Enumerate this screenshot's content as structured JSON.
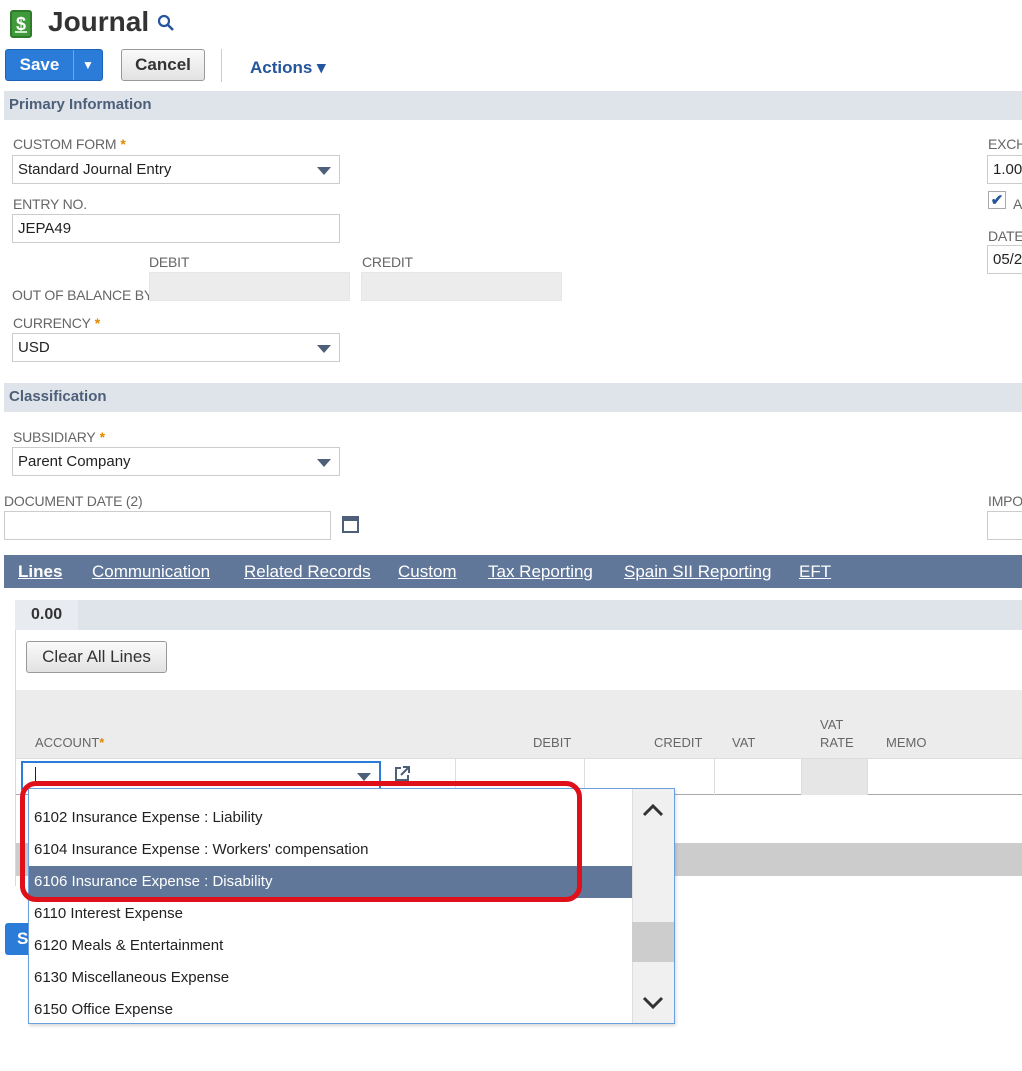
{
  "header": {
    "icon_glyph": "$",
    "title": "Journal"
  },
  "toolbar": {
    "save_label": "Save",
    "save_menu_glyph": "▼",
    "cancel_label": "Cancel",
    "actions_label": "Actions ▾"
  },
  "sections": {
    "primary": "Primary Information",
    "classification": "Classification"
  },
  "primary": {
    "custom_form_label": "Custom Form",
    "custom_form_value": "Standard Journal Entry",
    "entry_no_label": "Entry No.",
    "entry_no_value": "JEPA49",
    "debit_label": "Debit",
    "credit_label": "Credit",
    "out_of_balance_label": "Out of Balance By",
    "currency_label": "Currency",
    "currency_value": "USD",
    "exch_label": "EXCH",
    "exch_value": "1.00",
    "checkbox_label": "A",
    "checkbox_glyph": "✔",
    "date_label": "DATE",
    "date_value": "05/2"
  },
  "classification": {
    "subsidiary_label": "Subsidiary",
    "subsidiary_value": "Parent Company",
    "document_date_label": "Document Date (2)",
    "document_date_value": "",
    "impo_label": "IMPO"
  },
  "required_marker": "*",
  "tabs": [
    {
      "label": "Lines"
    },
    {
      "label": "Communication"
    },
    {
      "label": "Related Records"
    },
    {
      "label": "Custom"
    },
    {
      "label": "Tax Reporting"
    },
    {
      "label": "Spain SII Reporting"
    },
    {
      "label": "EFT"
    }
  ],
  "lines": {
    "total": "0.00",
    "clear_all_label": "Clear All Lines",
    "columns": {
      "account": "Account",
      "debit": "Debit",
      "credit": "Credit",
      "vat": "VAT",
      "vat_rate_1": "VAT",
      "vat_rate_2": "Rate",
      "memo": "Memo"
    }
  },
  "dropdown": {
    "items": [
      {
        "label": "6102 Insurance Expense : Liability",
        "selected": false
      },
      {
        "label": "6104 Insurance Expense : Workers' compensation",
        "selected": false
      },
      {
        "label": "6106 Insurance Expense : Disability",
        "selected": true
      },
      {
        "label": "6110 Interest Expense",
        "selected": false
      },
      {
        "label": "6120 Meals & Entertainment",
        "selected": false
      },
      {
        "label": "6130 Miscellaneous Expense",
        "selected": false
      },
      {
        "label": "6150 Office Expense",
        "selected": false
      }
    ]
  },
  "footer": {
    "save_stub": "S"
  },
  "colors": {
    "accent_blue": "#2b7bd8",
    "tab_bar": "#607799",
    "section_header": "#dfe4eb",
    "highlight_box": "#e0101a",
    "required_star": "#e08a00"
  }
}
